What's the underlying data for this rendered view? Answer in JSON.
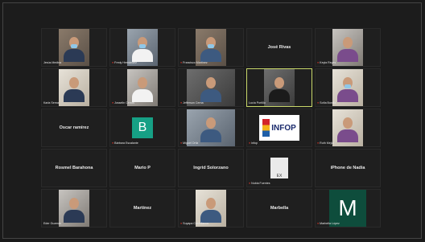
{
  "participants": [
    {
      "name": "Jesús Medina",
      "type": "video",
      "bg": "bg-a",
      "mask": true
    },
    {
      "name": "Fredy Hernández",
      "type": "video",
      "bg": "bg-b",
      "mask": true,
      "muted": true
    },
    {
      "name": "Francisco Martínez",
      "type": "video",
      "bg": "bg-a",
      "mask": true,
      "muted": true
    },
    {
      "name": "José Rivas",
      "type": "name"
    },
    {
      "name": "Keyla Reyes",
      "type": "video",
      "bg": "bg-d",
      "muted": true
    },
    {
      "name": "Karla Serna",
      "type": "video",
      "bg": "bg-c"
    },
    {
      "name": "Josselin Cerros",
      "type": "video",
      "bg": "bg-d",
      "muted": true
    },
    {
      "name": "Jefferson Cerna",
      "type": "video",
      "bg": "bg-e",
      "muted": true
    },
    {
      "name": "Lucía Portillo",
      "type": "video",
      "bg": "bg-e",
      "active": true
    },
    {
      "name": "Sofía Bonilla",
      "type": "video",
      "bg": "bg-c",
      "mask": true,
      "muted": true
    },
    {
      "name": "Oscar ramírez",
      "type": "name"
    },
    {
      "name": "Bárbara Escalante",
      "type": "letter",
      "letter": "B",
      "muted": true
    },
    {
      "name": "Miguel Ortiz",
      "type": "video",
      "bg": "bg-b",
      "muted": true
    },
    {
      "name": "infop",
      "type": "logo",
      "logo_text": "INFOP",
      "muted": true
    },
    {
      "name": "Ruth Mejía",
      "type": "video",
      "bg": "bg-c",
      "muted": true
    },
    {
      "name": "Rosmel Barahona",
      "type": "name"
    },
    {
      "name": "Mario P",
      "type": "name"
    },
    {
      "name": "Ingrid Solorzano",
      "type": "name"
    },
    {
      "name": "Nubia Fuentes",
      "type": "smalllogo",
      "logo_text": "EX",
      "muted": true
    },
    {
      "name": "iPhone de Nadia",
      "type": "name"
    },
    {
      "name": "Eder Guzmán",
      "type": "video",
      "bg": "bg-d"
    },
    {
      "name": "Martínez",
      "type": "name"
    },
    {
      "name": "Suyapa Castellanos",
      "type": "video",
      "bg": "bg-c",
      "muted": true
    },
    {
      "name": "Marbella",
      "type": "name"
    },
    {
      "name": "Marbella López",
      "type": "letter-big",
      "letter": "M",
      "muted": true
    }
  ],
  "icons": {
    "muted_mic": "mic-off-icon"
  },
  "colors": {
    "active_speaker_border": "#c9d86a",
    "muted_mic": "#e0392b"
  }
}
